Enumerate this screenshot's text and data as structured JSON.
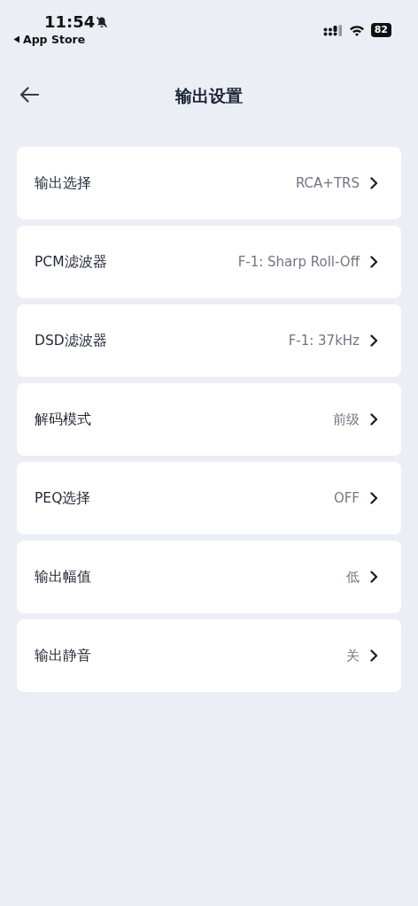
{
  "status_bar": {
    "time": "11:54",
    "back_label": "App Store",
    "battery": "82"
  },
  "header": {
    "title": "输出设置"
  },
  "settings": [
    {
      "label": "输出选择",
      "value": "RCA+TRS"
    },
    {
      "label": "PCM滤波器",
      "value": "F-1: Sharp Roll-Off"
    },
    {
      "label": "DSD滤波器",
      "value": "F-1: 37kHz"
    },
    {
      "label": "解码模式",
      "value": "前级"
    },
    {
      "label": "PEQ选择",
      "value": "OFF"
    },
    {
      "label": "输出幅值",
      "value": "低"
    },
    {
      "label": "输出静音",
      "value": "关"
    }
  ]
}
